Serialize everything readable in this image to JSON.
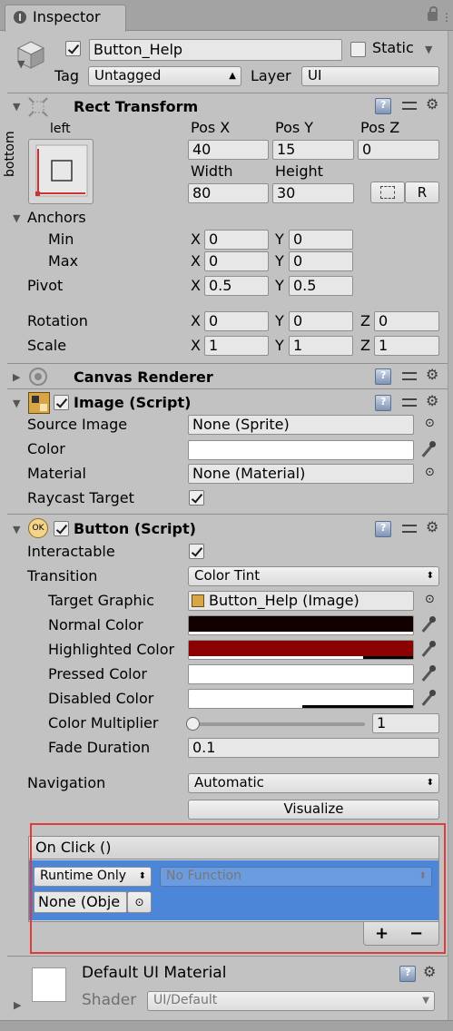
{
  "window": {
    "tab_title": "Inspector"
  },
  "gameobject": {
    "name": "Button_Help",
    "active": true,
    "static_label": "Static",
    "static_checked": false,
    "tag_label": "Tag",
    "tag_value": "Untagged",
    "layer_label": "Layer",
    "layer_value": "UI"
  },
  "rect_transform": {
    "title": "Rect Transform",
    "anchor_preset_h": "left",
    "anchor_preset_v": "bottom",
    "pos_x_label": "Pos X",
    "pos_y_label": "Pos Y",
    "pos_z_label": "Pos Z",
    "pos_x": "40",
    "pos_y": "15",
    "pos_z": "0",
    "width_label": "Width",
    "height_label": "Height",
    "width": "80",
    "height": "30",
    "raw_button": "R",
    "anchors_label": "Anchors",
    "min_label": "Min",
    "max_label": "Max",
    "min_x": "0",
    "min_y": "0",
    "max_x": "0",
    "max_y": "0",
    "pivot_label": "Pivot",
    "pivot_x": "0.5",
    "pivot_y": "0.5",
    "rotation_label": "Rotation",
    "rot_x": "0",
    "rot_y": "0",
    "rot_z": "0",
    "scale_label": "Scale",
    "scale_x": "1",
    "scale_y": "1",
    "scale_z": "1",
    "x": "X",
    "y": "Y",
    "z": "Z"
  },
  "canvas_renderer": {
    "title": "Canvas Renderer"
  },
  "image": {
    "title": "Image (Script)",
    "enabled": true,
    "source_image_label": "Source Image",
    "source_image": "None (Sprite)",
    "color_label": "Color",
    "color": "#ffffff",
    "material_label": "Material",
    "material": "None (Material)",
    "raycast_label": "Raycast Target",
    "raycast": true
  },
  "button": {
    "title": "Button (Script)",
    "enabled": true,
    "interactable_label": "Interactable",
    "interactable": true,
    "transition_label": "Transition",
    "transition": "Color Tint",
    "target_graphic_label": "Target Graphic",
    "target_graphic": "Button_Help (Image)",
    "normal_color_label": "Normal Color",
    "normal_color": "#120000",
    "highlighted_color_label": "Highlighted Color",
    "highlighted_color": "#8b0000",
    "pressed_color_label": "Pressed Color",
    "pressed_color": "#ffffff",
    "disabled_color_label": "Disabled Color",
    "disabled_color": "#ffffff",
    "color_multiplier_label": "Color Multiplier",
    "color_multiplier": "1",
    "fade_duration_label": "Fade Duration",
    "fade_duration": "0.1",
    "navigation_label": "Navigation",
    "navigation": "Automatic",
    "visualize_label": "Visualize",
    "onclick": {
      "title": "On Click ()",
      "runtime": "Runtime Only",
      "function": "No Function",
      "object": "None (Obje",
      "add": "+",
      "remove": "−"
    }
  },
  "material_section": {
    "name": "Default UI Material",
    "shader_label": "Shader",
    "shader": "UI/Default"
  }
}
